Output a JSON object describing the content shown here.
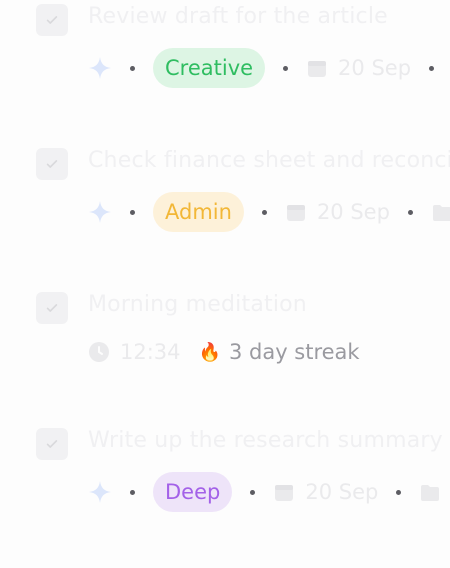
{
  "tasks": [
    {
      "title": "Review draft for the article",
      "tag": "Creative",
      "date": "20 Sep"
    },
    {
      "title": "Check finance sheet and reconcile",
      "tag": "Admin",
      "date": "20 Sep"
    },
    {
      "title": "Morning meditation",
      "time": "12:34",
      "streak": "3 day streak",
      "streak_icon": "🔥"
    },
    {
      "title": "Write up the research summary doc",
      "tag": "Deep",
      "date": "20 Sep"
    }
  ],
  "colors": {
    "creative_bg": "#ddf5e4",
    "creative_fg": "#2fbd61",
    "admin_bg": "#fdf1d9",
    "admin_fg": "#f2b737",
    "deep_bg": "#eee4f9",
    "deep_fg": "#a361e8",
    "sparkle": "#dce6fb"
  }
}
